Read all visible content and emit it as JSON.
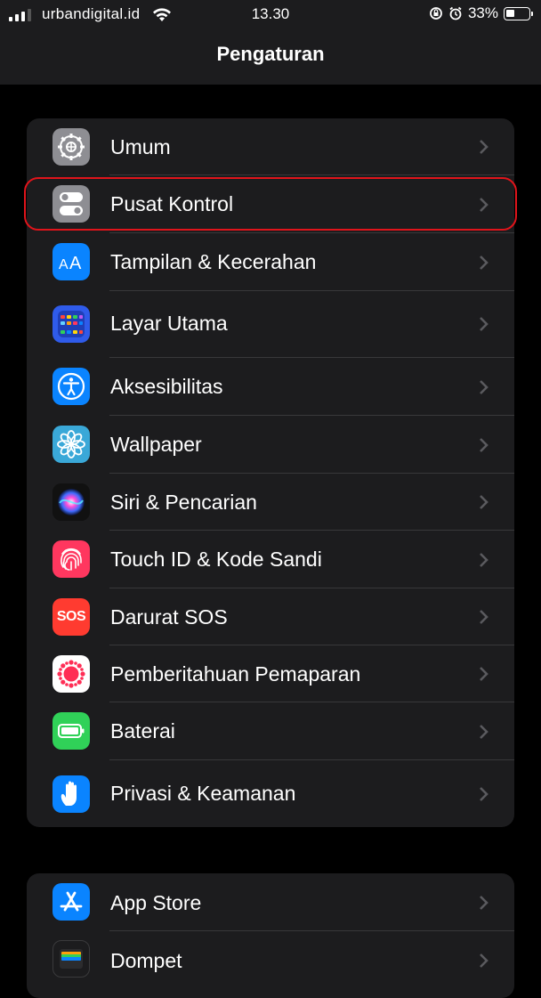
{
  "status_bar": {
    "carrier": "urbandigital.id",
    "time": "13.30",
    "battery_percent": "33%",
    "battery_level": 0.33
  },
  "header": {
    "title": "Pengaturan"
  },
  "groups": [
    {
      "items": [
        {
          "label": "Umum",
          "icon": "gear-icon",
          "color": "#8e8e93"
        },
        {
          "label": "Pusat Kontrol",
          "icon": "switches-icon",
          "color": "#8e8e93",
          "highlighted": true
        },
        {
          "label": "Tampilan & Kecerahan",
          "icon": "text-size-icon",
          "color": "#0a84ff"
        },
        {
          "label": "Layar Utama",
          "icon": "home-grid-icon",
          "color": "#2f5bea"
        },
        {
          "label": "Aksesibilitas",
          "icon": "accessibility-icon",
          "color": "#0a84ff"
        },
        {
          "label": "Wallpaper",
          "icon": "flower-icon",
          "color": "#3aa8d8"
        },
        {
          "label": "Siri & Pencarian",
          "icon": "siri-icon",
          "color": "#111111"
        },
        {
          "label": "Touch ID & Kode Sandi",
          "icon": "fingerprint-icon",
          "color": "#ff375f"
        },
        {
          "label": "Darurat SOS",
          "icon": "sos-icon",
          "color": "#ff3b30",
          "icon_text": "SOS"
        },
        {
          "label": "Pemberitahuan Pemaparan",
          "icon": "exposure-icon",
          "color": "#ffffff"
        },
        {
          "label": "Baterai",
          "icon": "battery-icon",
          "color": "#30d158"
        },
        {
          "label": "Privasi & Keamanan",
          "icon": "hand-icon",
          "color": "#0a84ff"
        }
      ]
    },
    {
      "items": [
        {
          "label": "App Store",
          "icon": "app-store-icon",
          "color": "#0a84ff"
        },
        {
          "label": "Dompet",
          "icon": "wallet-icon",
          "color": "#1c1c1e"
        }
      ]
    }
  ]
}
